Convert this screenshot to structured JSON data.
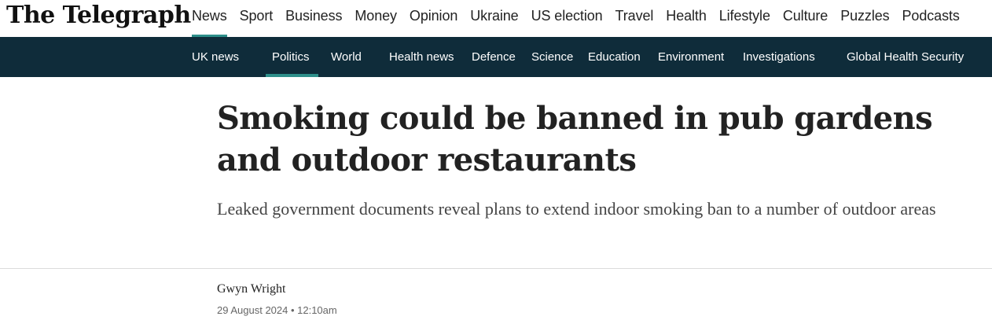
{
  "brand": {
    "logo_text": "The Telegraph"
  },
  "top_nav": {
    "items": [
      {
        "label": "News"
      },
      {
        "label": "Sport"
      },
      {
        "label": "Business"
      },
      {
        "label": "Money"
      },
      {
        "label": "Opinion"
      },
      {
        "label": "Ukraine"
      },
      {
        "label": "US election"
      },
      {
        "label": "Travel"
      },
      {
        "label": "Health"
      },
      {
        "label": "Lifestyle"
      },
      {
        "label": "Culture"
      },
      {
        "label": "Puzzles"
      },
      {
        "label": "Podcasts"
      }
    ],
    "active": "News",
    "accent_color": "#2e8f8a"
  },
  "sub_nav": {
    "items": [
      {
        "label": "UK news"
      },
      {
        "label": "Politics"
      },
      {
        "label": "World"
      },
      {
        "label": "Health news"
      },
      {
        "label": "Defence"
      },
      {
        "label": "Science"
      },
      {
        "label": "Education"
      },
      {
        "label": "Environment"
      },
      {
        "label": "Investigations"
      },
      {
        "label": "Global Health Security"
      }
    ],
    "active": "Politics",
    "background_color": "#0f2c3a"
  },
  "article": {
    "headline": "Smoking could be banned in pub gardens and outdoor restaurants",
    "standfirst": "Leaked government documents reveal plans to extend indoor smoking ban to a number of outdoor areas",
    "author": "Gwyn Wright",
    "date": "29 August 2024 • 12:10am"
  }
}
